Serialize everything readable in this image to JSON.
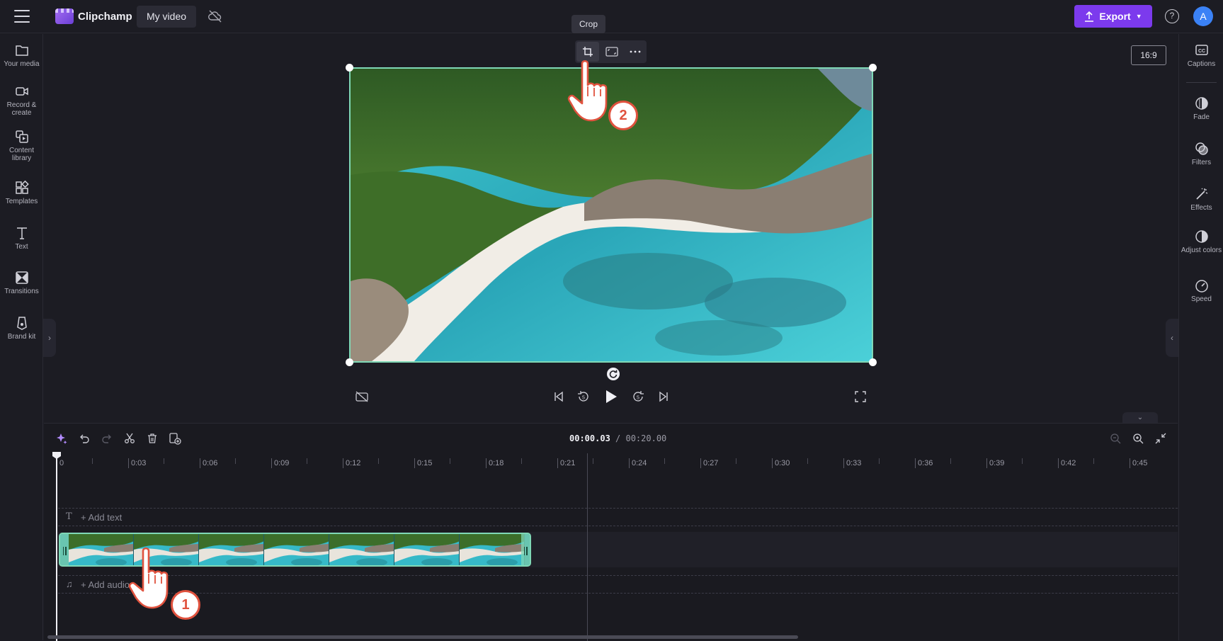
{
  "app": {
    "name": "Clipchamp",
    "project_title": "My video",
    "export_label": "Export",
    "help_label": "?",
    "avatar_initial": "A",
    "accent_color": "#7c3aed"
  },
  "left_sidebar": {
    "items": [
      {
        "label": "Your media",
        "icon": "folder-icon"
      },
      {
        "label": "Record & create",
        "icon": "camera-icon"
      },
      {
        "label": "Content library",
        "icon": "library-icon"
      },
      {
        "label": "Templates",
        "icon": "templates-icon"
      },
      {
        "label": "Text",
        "icon": "text-icon"
      },
      {
        "label": "Transitions",
        "icon": "transitions-icon"
      },
      {
        "label": "Brand kit",
        "icon": "brand-kit-icon"
      }
    ]
  },
  "right_sidebar": {
    "items": [
      {
        "label": "Captions",
        "icon": "captions-icon"
      },
      {
        "label": "Fade",
        "icon": "fade-icon"
      },
      {
        "label": "Filters",
        "icon": "filters-icon"
      },
      {
        "label": "Effects",
        "icon": "effects-icon"
      },
      {
        "label": "Adjust colors",
        "icon": "adjust-colors-icon"
      },
      {
        "label": "Speed",
        "icon": "speed-icon"
      }
    ]
  },
  "preview": {
    "aspect_ratio": "16:9",
    "tooltip": "Crop",
    "selection_color": "#7fd8b6"
  },
  "timeline": {
    "current_time": "00:00.03",
    "total_time": "/ 00:20.00",
    "ruler_labels": [
      "0",
      "0:03",
      "0:06",
      "0:09",
      "0:12",
      "0:15",
      "0:18",
      "0:21",
      "0:24",
      "0:27",
      "0:30",
      "0:33",
      "0:36",
      "0:39",
      "0:42",
      "0:45"
    ],
    "add_text_label": "+ Add text",
    "add_audio_label": "+ Add audio"
  },
  "annotations": {
    "step1": "1",
    "step2": "2",
    "badge_color": "#e0523e"
  }
}
